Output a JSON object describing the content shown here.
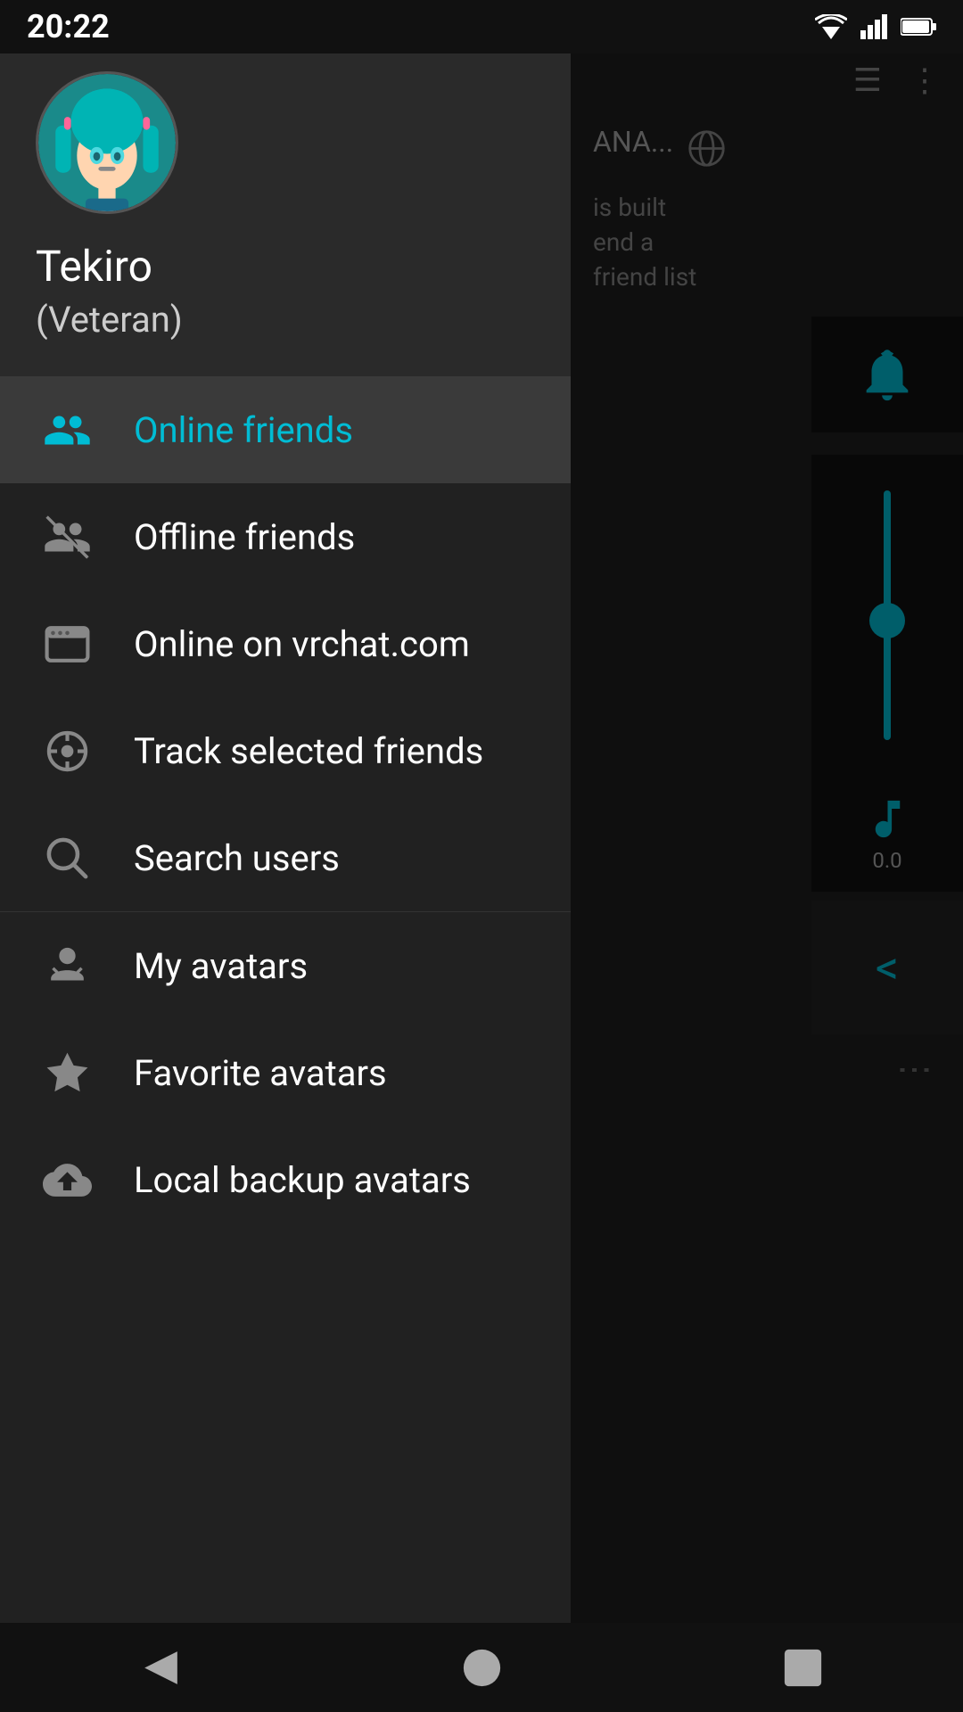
{
  "statusBar": {
    "time": "20:22"
  },
  "user": {
    "name": "Tekiro",
    "rank": "(Veteran)"
  },
  "drawer": {
    "menuItems": [
      {
        "id": "online-friends",
        "label": "Online friends",
        "icon": "online-friends-icon",
        "active": true
      },
      {
        "id": "offline-friends",
        "label": "Offline friends",
        "icon": "offline-friends-icon",
        "active": false
      },
      {
        "id": "online-vrchat",
        "label": "Online on vrchat.com",
        "icon": "browser-icon",
        "active": false
      },
      {
        "id": "track-friends",
        "label": "Track selected friends",
        "icon": "track-icon",
        "active": false
      },
      {
        "id": "search-users",
        "label": "Search users",
        "icon": "search-icon",
        "active": false
      },
      {
        "id": "my-avatars",
        "label": "My avatars",
        "icon": "avatar-icon",
        "active": false
      },
      {
        "id": "favorite-avatars",
        "label": "Favorite avatars",
        "icon": "star-icon",
        "active": false
      },
      {
        "id": "local-backup",
        "label": "Local backup avatars",
        "icon": "cloud-icon",
        "active": false
      }
    ]
  },
  "rightPanel": {
    "title": "ANA...",
    "text": "is built\nend a\nfriend list",
    "musicValue": "0.0"
  },
  "bottomNav": {
    "back": "back-nav",
    "home": "home-nav",
    "recent": "recent-nav"
  }
}
